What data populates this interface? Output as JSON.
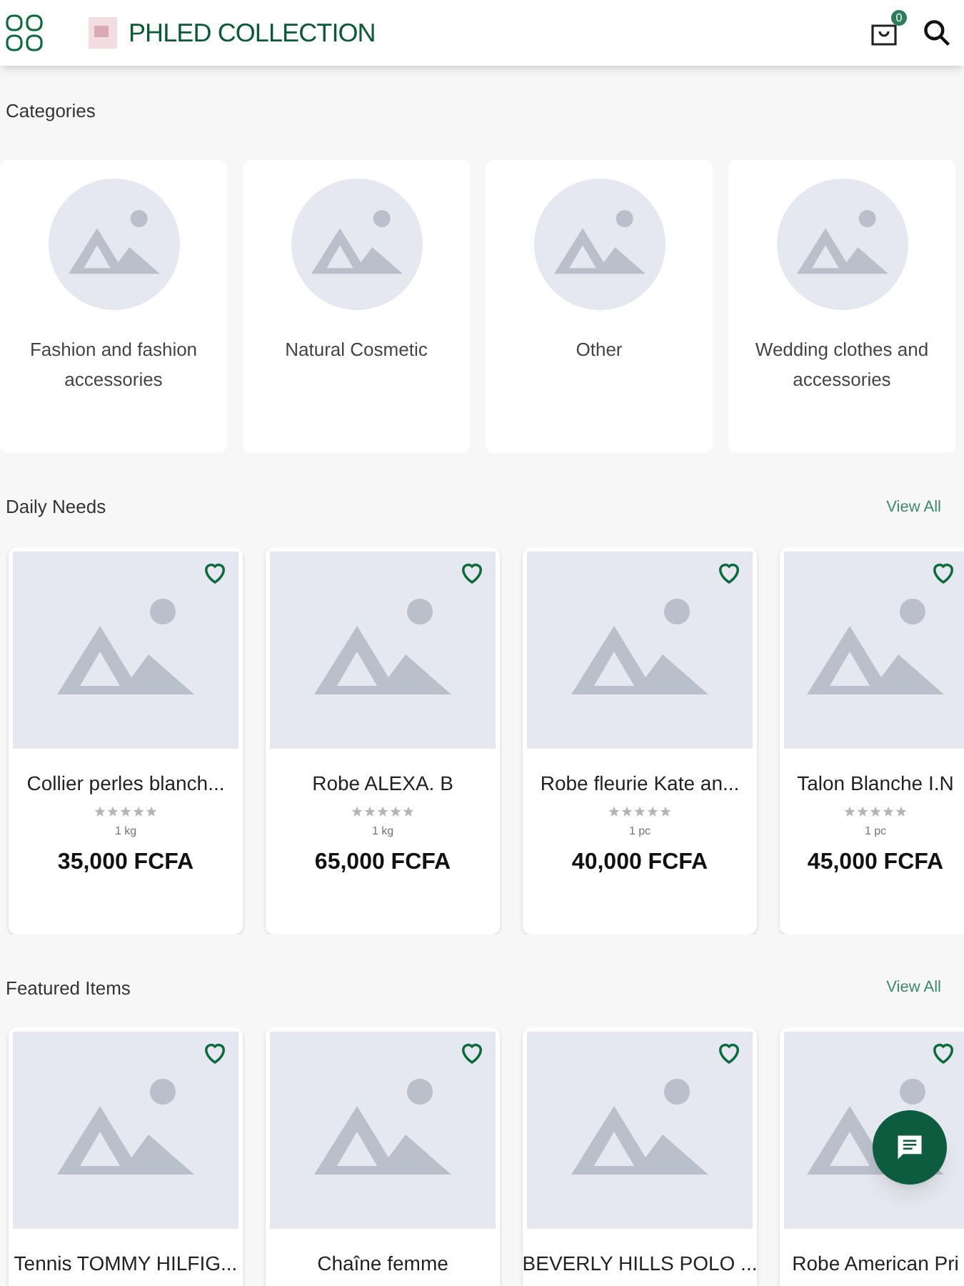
{
  "header": {
    "title": "PHLED COLLECTION",
    "cart_count": "0"
  },
  "categories": {
    "title": "Categories",
    "items": [
      {
        "name": "Fashion and fashion accessories"
      },
      {
        "name": "Natural Cosmetic"
      },
      {
        "name": "Other"
      },
      {
        "name": "Wedding clothes and accessories"
      }
    ]
  },
  "daily_needs": {
    "title": "Daily Needs",
    "view_all": "View All",
    "products": [
      {
        "name": "Collier perles blanch...",
        "stars": 0,
        "unit": "1 kg",
        "price": "35,000 FCFA"
      },
      {
        "name": "Robe ALEXA. B",
        "stars": 0,
        "unit": "1 kg",
        "price": "65,000 FCFA"
      },
      {
        "name": "Robe fleurie Kate an...",
        "stars": 0,
        "unit": "1 pc",
        "price": "40,000 FCFA"
      },
      {
        "name": "Talon Blanche I.N",
        "stars": 0,
        "unit": "1 pc",
        "price": "45,000 FCFA"
      }
    ]
  },
  "featured_items": {
    "title": "Featured Items",
    "view_all": "View All",
    "products": [
      {
        "name": "Tennis TOMMY HILFIG..."
      },
      {
        "name": "Chaîne femme"
      },
      {
        "name": "BEVERLY HILLS POLO ..."
      },
      {
        "name": "Robe American Pri"
      }
    ]
  }
}
